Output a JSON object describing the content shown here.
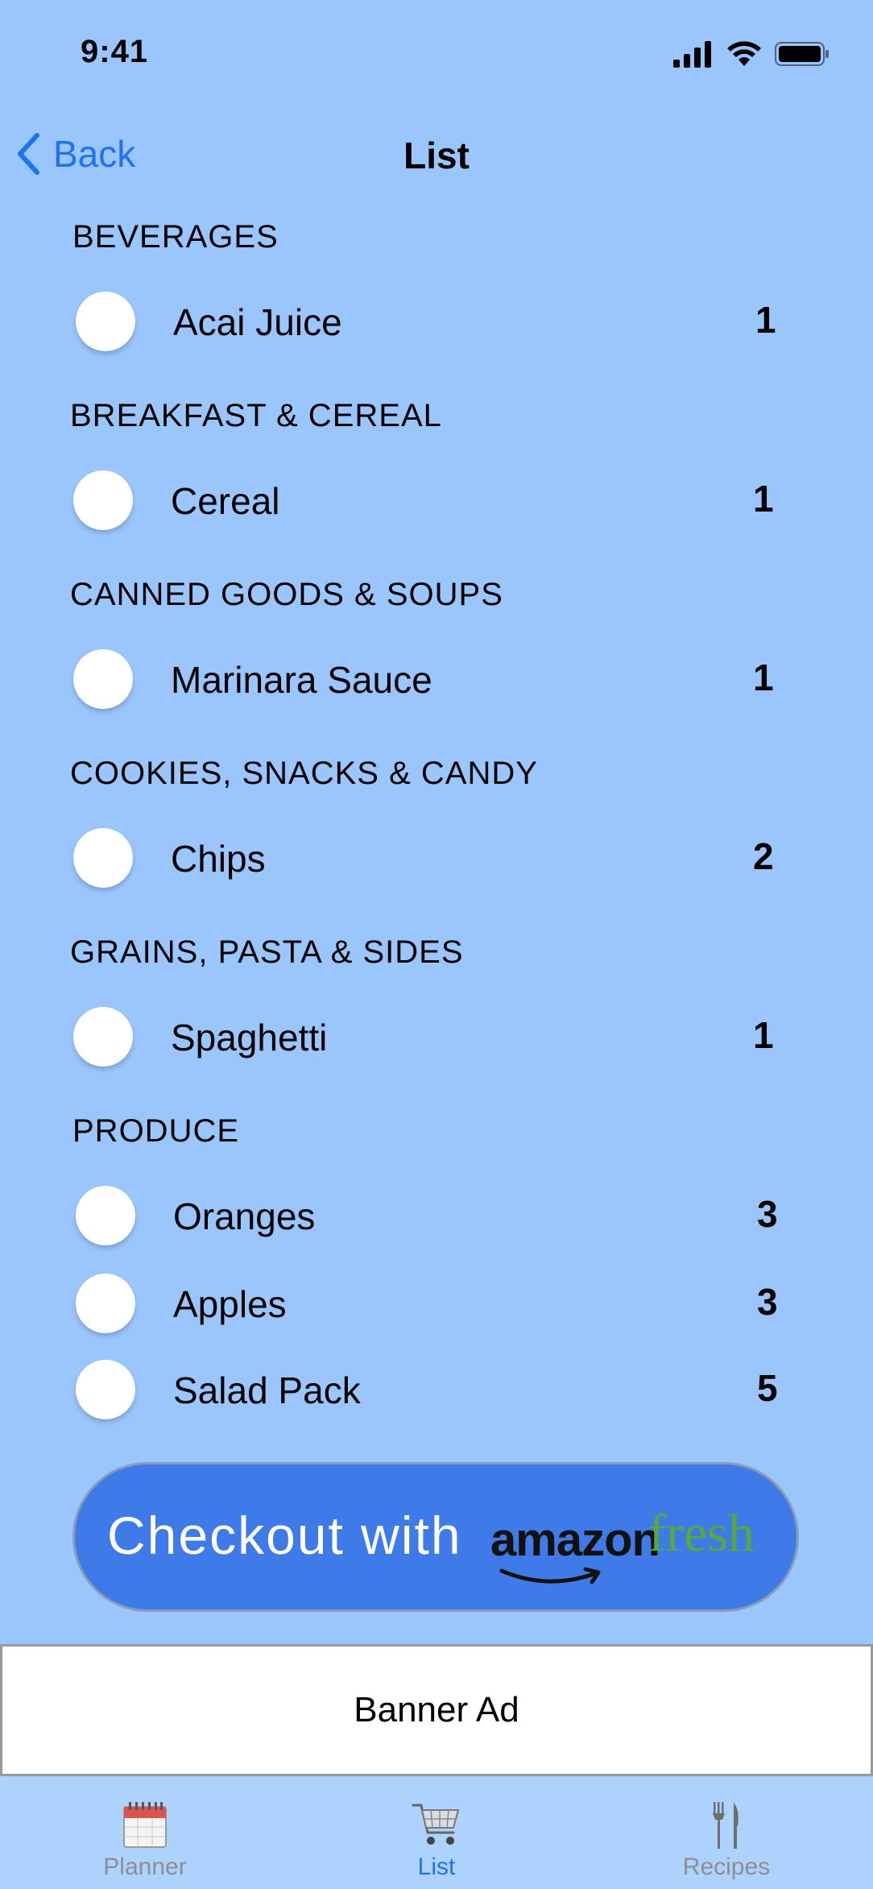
{
  "status": {
    "time": "9:41"
  },
  "nav": {
    "back_label": "Back",
    "title": "List"
  },
  "sections": [
    {
      "header": "BEVERAGES",
      "items": [
        {
          "name": "Acai Juice",
          "qty": "1"
        }
      ]
    },
    {
      "header": "BREAKFAST & CEREAL",
      "items": [
        {
          "name": "Cereal",
          "qty": "1"
        }
      ]
    },
    {
      "header": "CANNED GOODS & SOUPS",
      "items": [
        {
          "name": "Marinara Sauce",
          "qty": "1"
        }
      ]
    },
    {
      "header": "COOKIES, SNACKS & CANDY",
      "items": [
        {
          "name": "Chips",
          "qty": "2"
        }
      ]
    },
    {
      "header": "GRAINS, PASTA & SIDES",
      "items": [
        {
          "name": "Spaghetti",
          "qty": "1"
        }
      ]
    },
    {
      "header": "PRODUCE",
      "items": [
        {
          "name": "Oranges",
          "qty": "3"
        },
        {
          "name": "Apples",
          "qty": "3"
        },
        {
          "name": "Salad Pack",
          "qty": "5"
        }
      ]
    }
  ],
  "checkout": {
    "label": "Checkout with",
    "brand_amazon": "amazon",
    "brand_fresh": "fresh"
  },
  "banner": {
    "label": "Banner Ad"
  },
  "tabs": [
    {
      "label": "Planner",
      "icon": "calendar-icon",
      "active": false
    },
    {
      "label": "List",
      "icon": "shopping-cart-icon",
      "active": true
    },
    {
      "label": "Recipes",
      "icon": "fork-knife-icon",
      "active": false
    }
  ],
  "colors": {
    "background": "#9ac6fd",
    "accent": "#1f73f0",
    "checkout": "#3f7be8",
    "fresh_green": "#5aa83a",
    "tab_bar": "#acd2fd"
  }
}
